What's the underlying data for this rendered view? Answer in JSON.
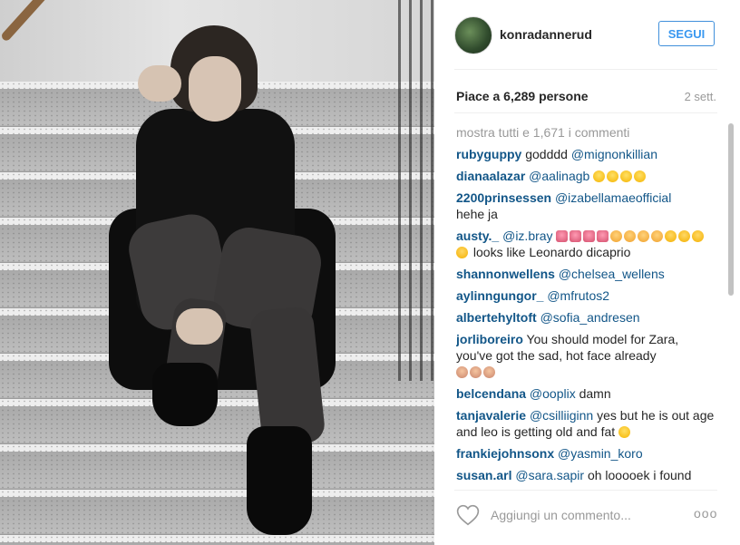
{
  "header": {
    "username": "konradannerud",
    "follow_label": "SEGUI"
  },
  "stats": {
    "likes": "Piace a 6,289 persone",
    "time": "2 sett."
  },
  "comments": {
    "load_all": "mostra tutti e 1,671 i commenti",
    "items": [
      {
        "user": "rubyguppy",
        "text": "godddd",
        "mention": "@mignonkillian"
      },
      {
        "user": "dianaalazar",
        "mention": "@aalinagb",
        "emoji": [
          "laugh",
          "laugh",
          "laugh",
          "laugh"
        ]
      },
      {
        "user": "2200prinsessen",
        "mention": "@izabellamaeofficial",
        "text2": "hehe ja"
      },
      {
        "user": "austy._",
        "mention": "@iz.bray",
        "emoji": [
          "tongue",
          "tongue",
          "tongue",
          "tongue",
          "cat",
          "cat",
          "cat",
          "cat",
          "heart",
          "heart",
          "heart",
          "heart"
        ],
        "text": "looks like Leonardo dicaprio"
      },
      {
        "user": "shannonwellens",
        "mention": "@chelsea_wellens"
      },
      {
        "user": "aylinngungor_",
        "mention": "@mfrutos2"
      },
      {
        "user": "albertehyltoft",
        "mention": "@sofia_andresen"
      },
      {
        "user": "jorliboreiro",
        "text": "You should model for Zara, you've got the sad, hot face already",
        "emoji": [
          "girl",
          "girl",
          "girl"
        ]
      },
      {
        "user": "belcendana",
        "mention": "@ooplix",
        "text": "damn"
      },
      {
        "user": "tanjavalerie",
        "mention": "@csilliiginn",
        "text": "yes but he is out age and leo is getting old and fat",
        "emoji": [
          "laugh"
        ]
      },
      {
        "user": "frankiejohnsonx",
        "mention": "@yasmin_koro"
      },
      {
        "user": "susan.arl",
        "mention": "@sara.sapir",
        "text": "oh looooek i found"
      }
    ]
  },
  "footer": {
    "comment_placeholder": "Aggiungi un commento...",
    "more_label": "ooo"
  },
  "colors": {
    "link": "#125688",
    "follow": "#3897f0",
    "muted": "#999999"
  }
}
